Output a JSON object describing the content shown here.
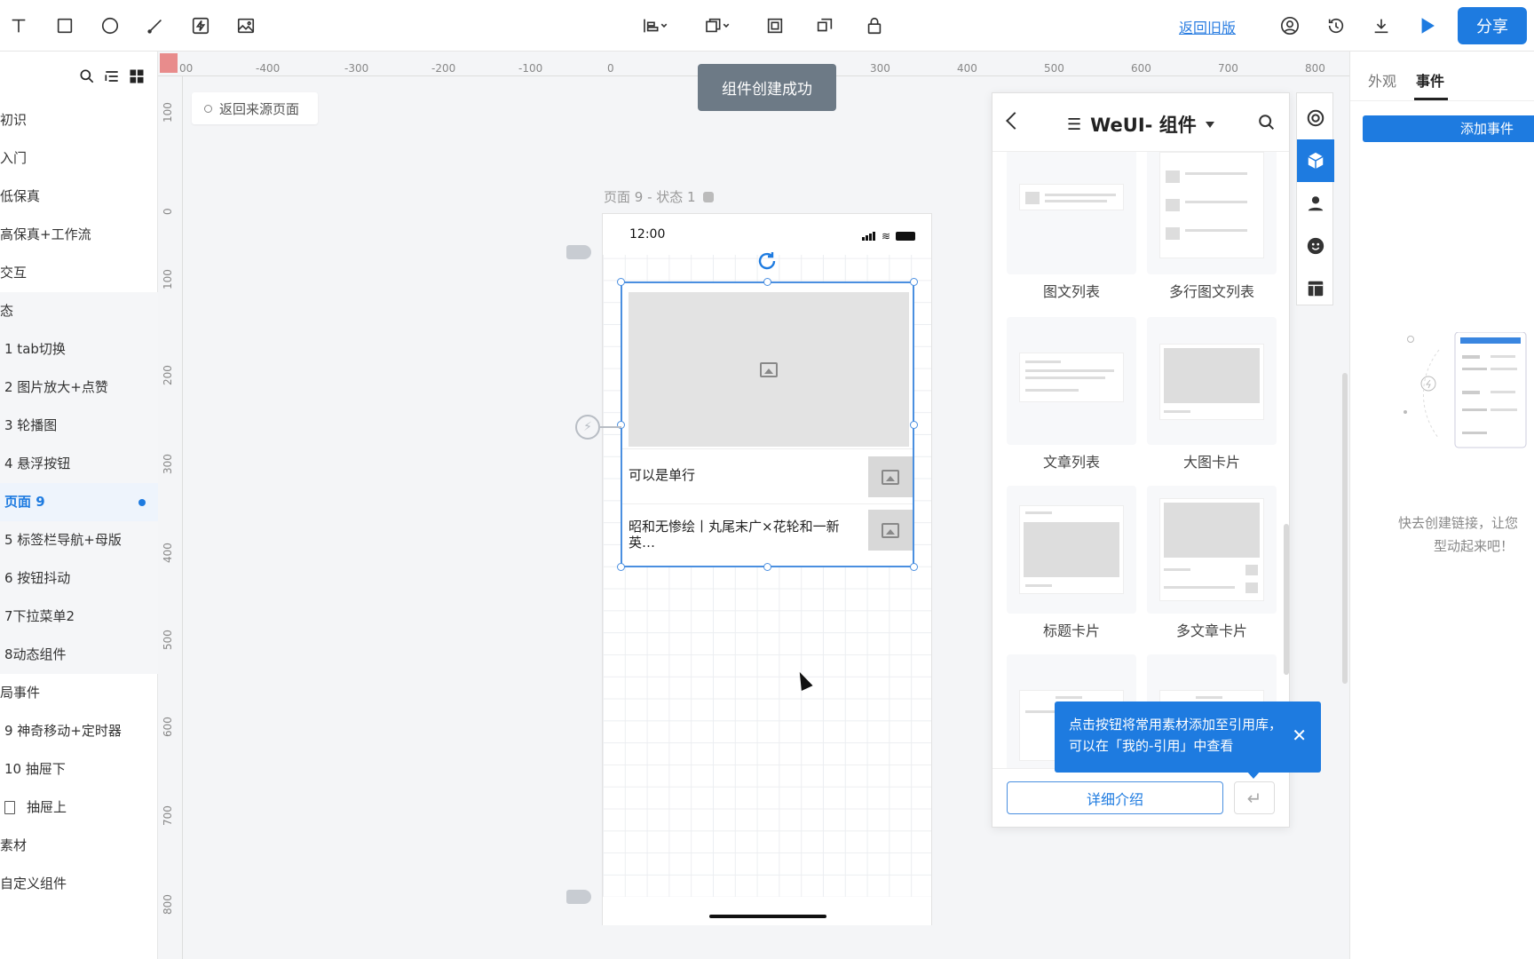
{
  "toolbar": {
    "back_to_old": "返回旧版",
    "share": "分享"
  },
  "sidebar": {
    "items": [
      {
        "label": "初识",
        "kind": "top"
      },
      {
        "label": "入门",
        "kind": "top"
      },
      {
        "label": "低保真",
        "kind": "top"
      },
      {
        "label": "高保真+工作流",
        "kind": "top"
      },
      {
        "label": "交互",
        "kind": "top"
      },
      {
        "label": "态",
        "kind": "group"
      },
      {
        "label": "1 tab切换",
        "kind": "sub"
      },
      {
        "label": "2 图片放大+点赞",
        "kind": "sub"
      },
      {
        "label": "3 轮播图",
        "kind": "sub"
      },
      {
        "label": "4 悬浮按钮",
        "kind": "sub"
      },
      {
        "label": "页面 9",
        "kind": "active"
      },
      {
        "label": "5 标签栏导航+母版",
        "kind": "sub"
      },
      {
        "label": "6 按钮抖动",
        "kind": "sub"
      },
      {
        "label": "7下拉菜单2",
        "kind": "sub"
      },
      {
        "label": "8动态组件",
        "kind": "sub"
      },
      {
        "label": "局事件",
        "kind": "top"
      },
      {
        "label": "9 神奇移动+定时器",
        "kind": "sub"
      },
      {
        "label": "10 抽屉下",
        "kind": "sub"
      },
      {
        "label": "抽屉上",
        "kind": "doc"
      },
      {
        "label": "素材",
        "kind": "top"
      },
      {
        "label": "自定义组件",
        "kind": "top"
      }
    ]
  },
  "ruler": {
    "top": [
      "00",
      "-400",
      "-300",
      "-200",
      "-100",
      "0",
      "300",
      "400",
      "500",
      "600",
      "700",
      "800"
    ],
    "left": [
      "100",
      "0",
      "100",
      "200",
      "300",
      "400",
      "500",
      "600",
      "700",
      "800"
    ]
  },
  "canvas": {
    "return_source": "返回来源页面",
    "toast": "组件创建成功",
    "page_label": "页面 9 - 状态 1",
    "phone_time": "12:00",
    "row1_text": "可以是单行",
    "row2_text": "昭和无惨绘丨丸尾末广×花轮和一新英…"
  },
  "weui": {
    "title": "WeUI- 组件",
    "cards": [
      {
        "label": "图文列表"
      },
      {
        "label": "多行图文列表"
      },
      {
        "label": "文章列表"
      },
      {
        "label": "大图卡片"
      },
      {
        "label": "标题卡片"
      },
      {
        "label": "多文章卡片"
      }
    ],
    "detail_button": "详细介绍",
    "tip": "点击按钮将常用素材添加至引用库，可以在「我的-引用」中查看"
  },
  "right_panel": {
    "tab_appearance": "外观",
    "tab_events": "事件",
    "add_event": "添加事件",
    "hint_line1": "快去创建链接，让您",
    "hint_line2": "型动起来吧！"
  },
  "colors": {
    "accent": "#1e7be0",
    "tip_bg": "#1e7be0",
    "toast_bg": "#6d7a86"
  }
}
